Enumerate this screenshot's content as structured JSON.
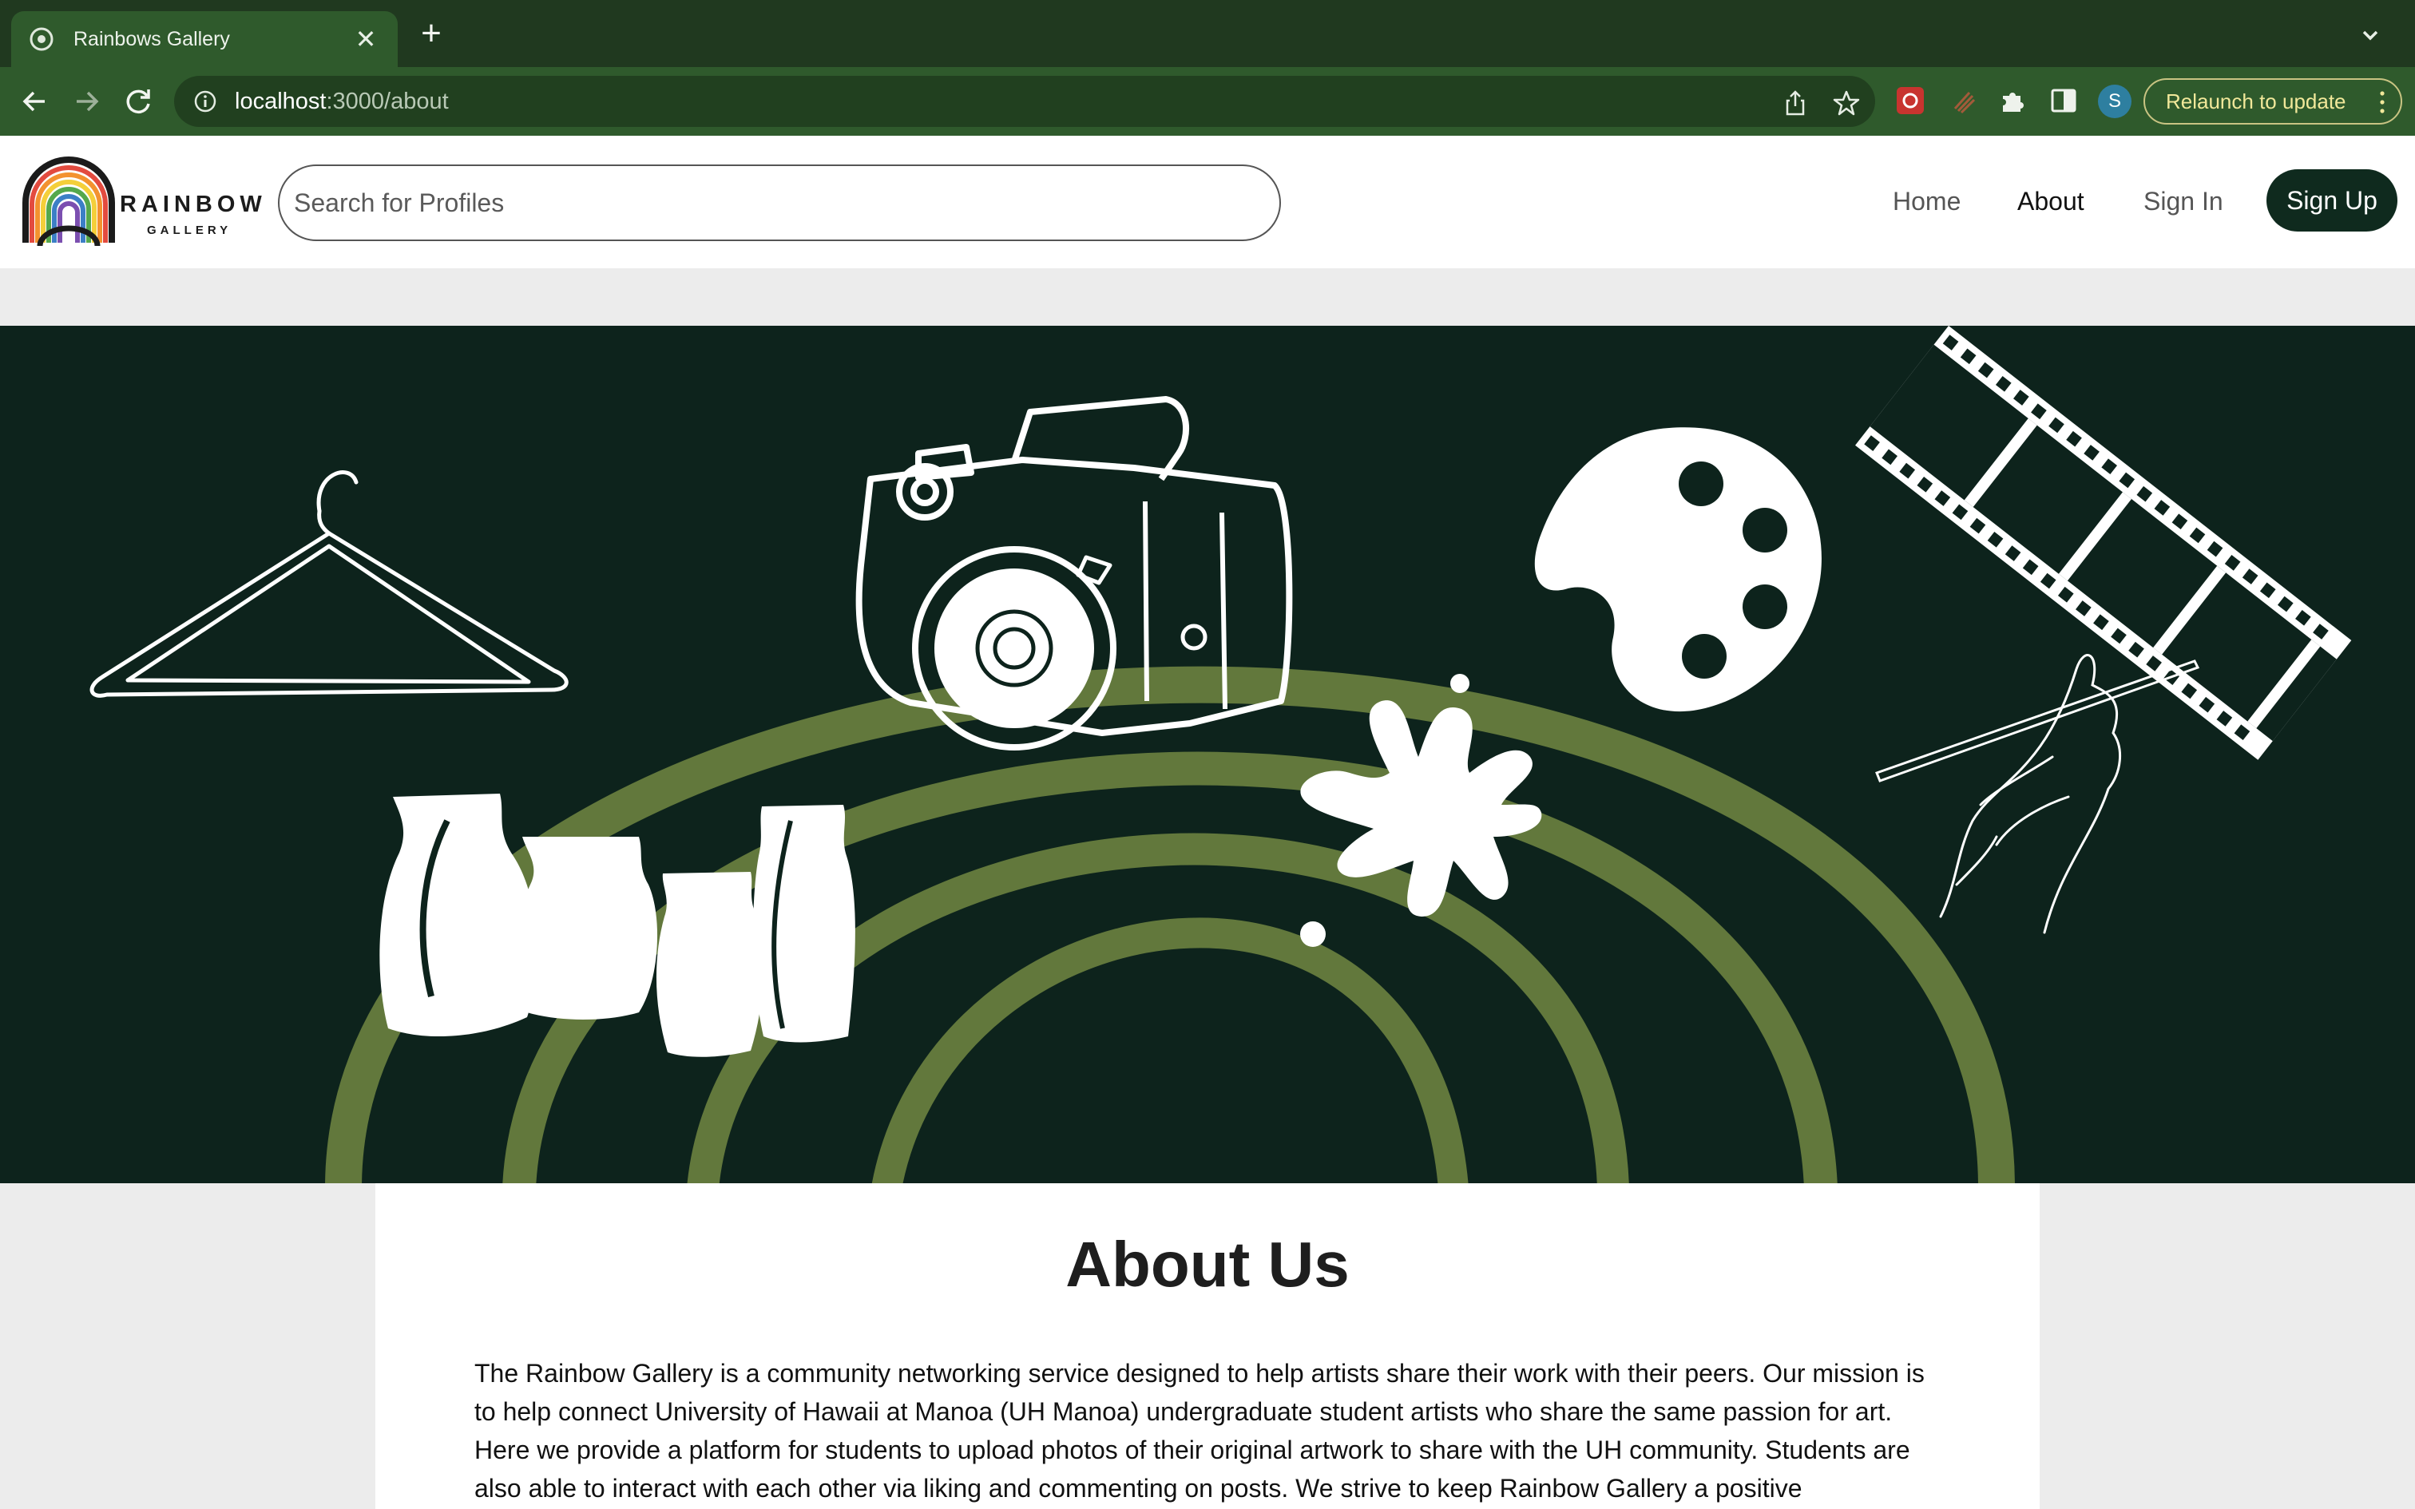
{
  "browser": {
    "tab_title": "Rainbows Gallery",
    "url_host": "localhost",
    "url_path": ":3000/about",
    "profile_initial": "S",
    "relaunch_label": "Relaunch to update"
  },
  "header": {
    "logo_word": "RAINBOW",
    "logo_sub": "GALLERY",
    "search_placeholder": "Search for Profiles",
    "nav": {
      "home": "Home",
      "about": "About",
      "signin": "Sign In",
      "signup": "Sign Up"
    }
  },
  "hero": {
    "icons": [
      "hanger-icon",
      "camera-icon",
      "palette-icon",
      "film-strip-icon",
      "vases-icon",
      "paint-splash-icon",
      "hand-pencil-icon"
    ]
  },
  "about": {
    "title": "About Us",
    "body": "The Rainbow Gallery is a community networking service designed to help artists share their work with their peers. Our mission is to help connect University of Hawaii at Manoa (UH Manoa) undergraduate student artists who share the same passion for art. Here we provide a platform for students to upload photos of their original artwork to share with the UH community. Students are also able to interact with each other via liking and commenting on posts. We strive to keep Rainbow Gallery a positive environment and"
  },
  "colors": {
    "hero_bg": "#0d231c",
    "rainbow_green": "#62783c",
    "brand_dark": "#0f2a1e",
    "chrome_green": "#2f5a2c"
  }
}
